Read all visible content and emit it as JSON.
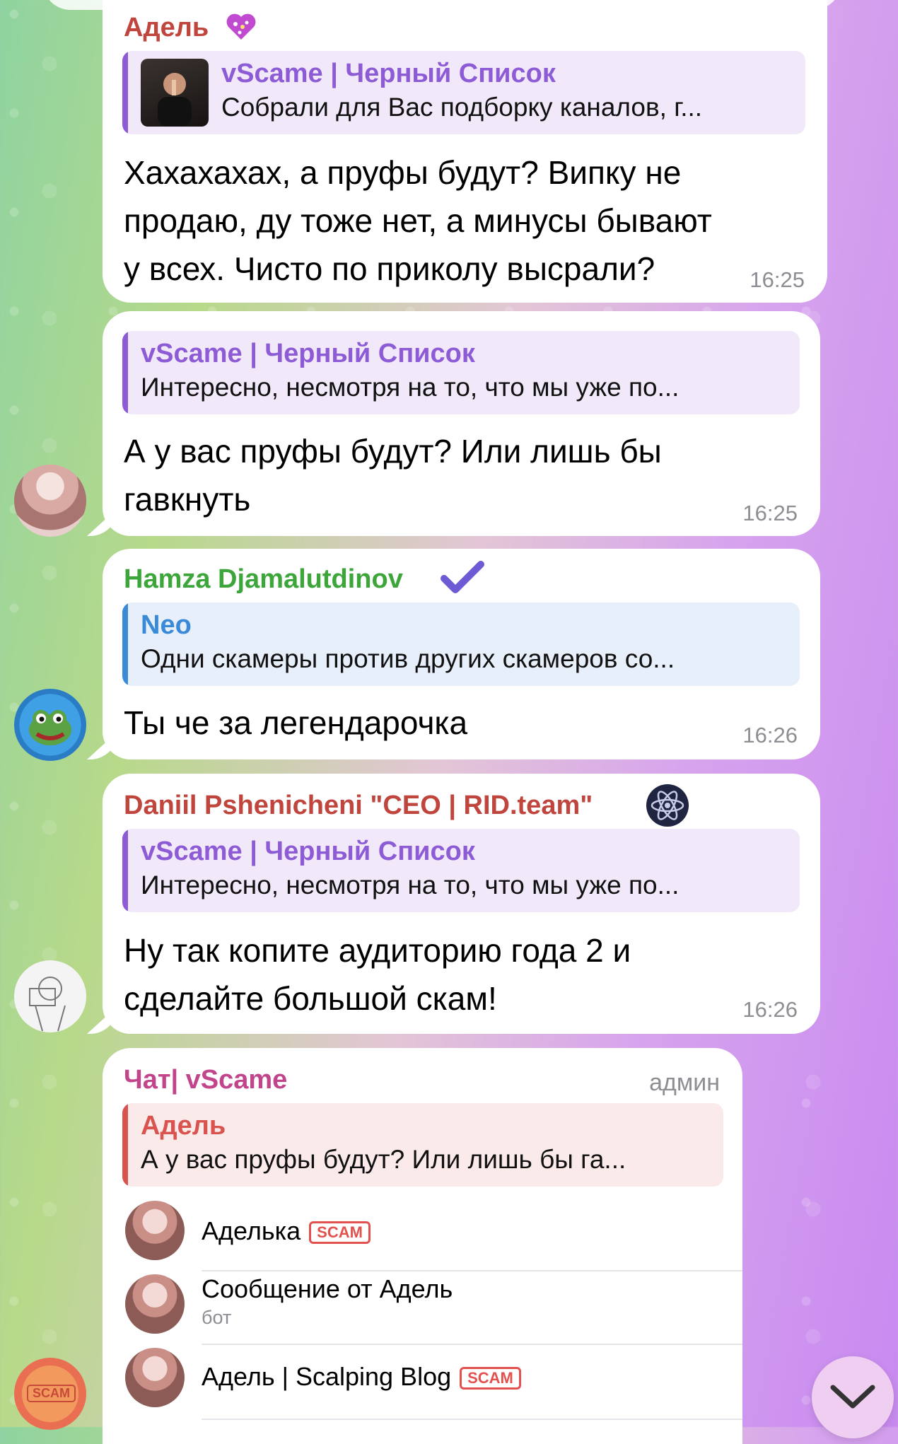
{
  "colors": {
    "accent_purple": "#8e5bd6",
    "sender_adel": "#c0453d",
    "sender_hamza": "#3da63a",
    "sender_daniil": "#c0453d",
    "sender_chat": "#c2448a",
    "reply_blue": "#3a8ad8",
    "reply_red": "#d9534f",
    "timestamp": "#8d8d93"
  },
  "messages": [
    {
      "sender": "Адель",
      "sender_badge_icon": "heart-sparkle-icon",
      "reply": {
        "title": "vScame | Черный Список",
        "text": "Собрали для Вас подборку каналов, г..."
      },
      "text_lines": [
        "Хахахахах, а пруфы будут? Випку не",
        "продаю, ду тоже нет, а минусы бывают",
        "у всех. Чисто по приколу высрали?"
      ],
      "time": "16:25"
    },
    {
      "reply": {
        "title": "vScame | Черный Список",
        "text": "Интересно, несмотря на то, что мы уже по..."
      },
      "text_lines": [
        "А у вас пруфы будут? Или лишь бы",
        "гавкнуть"
      ],
      "time": "16:25"
    },
    {
      "sender": "Hamza Djamalutdinov",
      "sender_badge_icon": "checkmark-badge-icon",
      "reply": {
        "title": "Neo",
        "text": "Одни скамеры против других скамеров со..."
      },
      "text_lines": [
        "Ты че за легендарочка"
      ],
      "time": "16:26"
    },
    {
      "sender": "Daniil Pshenicheni \"CEO | RID.team\"",
      "sender_badge_icon": "atom-icon",
      "reply": {
        "title": "vScame | Черный Список",
        "text": "Интересно, несмотря на то, что мы уже по..."
      },
      "text_lines": [
        "Ну так копите аудиторию года 2 и",
        "сделайте большой скам!"
      ],
      "time": "16:26"
    },
    {
      "sender": "Чат| vScame",
      "role": "админ",
      "reply": {
        "title": "Адель",
        "text": "А у вас пруфы будут? Или лишь бы га..."
      },
      "accounts": [
        {
          "name": "Аделька",
          "badge": "SCAM",
          "sub": ""
        },
        {
          "name": "Сообщение от Адель",
          "badge": "",
          "sub": "бот"
        },
        {
          "name": "Адель | Scalping Blog",
          "badge": "SCAM",
          "sub": ""
        }
      ]
    }
  ],
  "avatars": {
    "bottom_left_badge": "SCAM"
  },
  "scroll_button_icon": "chevron-down-icon"
}
